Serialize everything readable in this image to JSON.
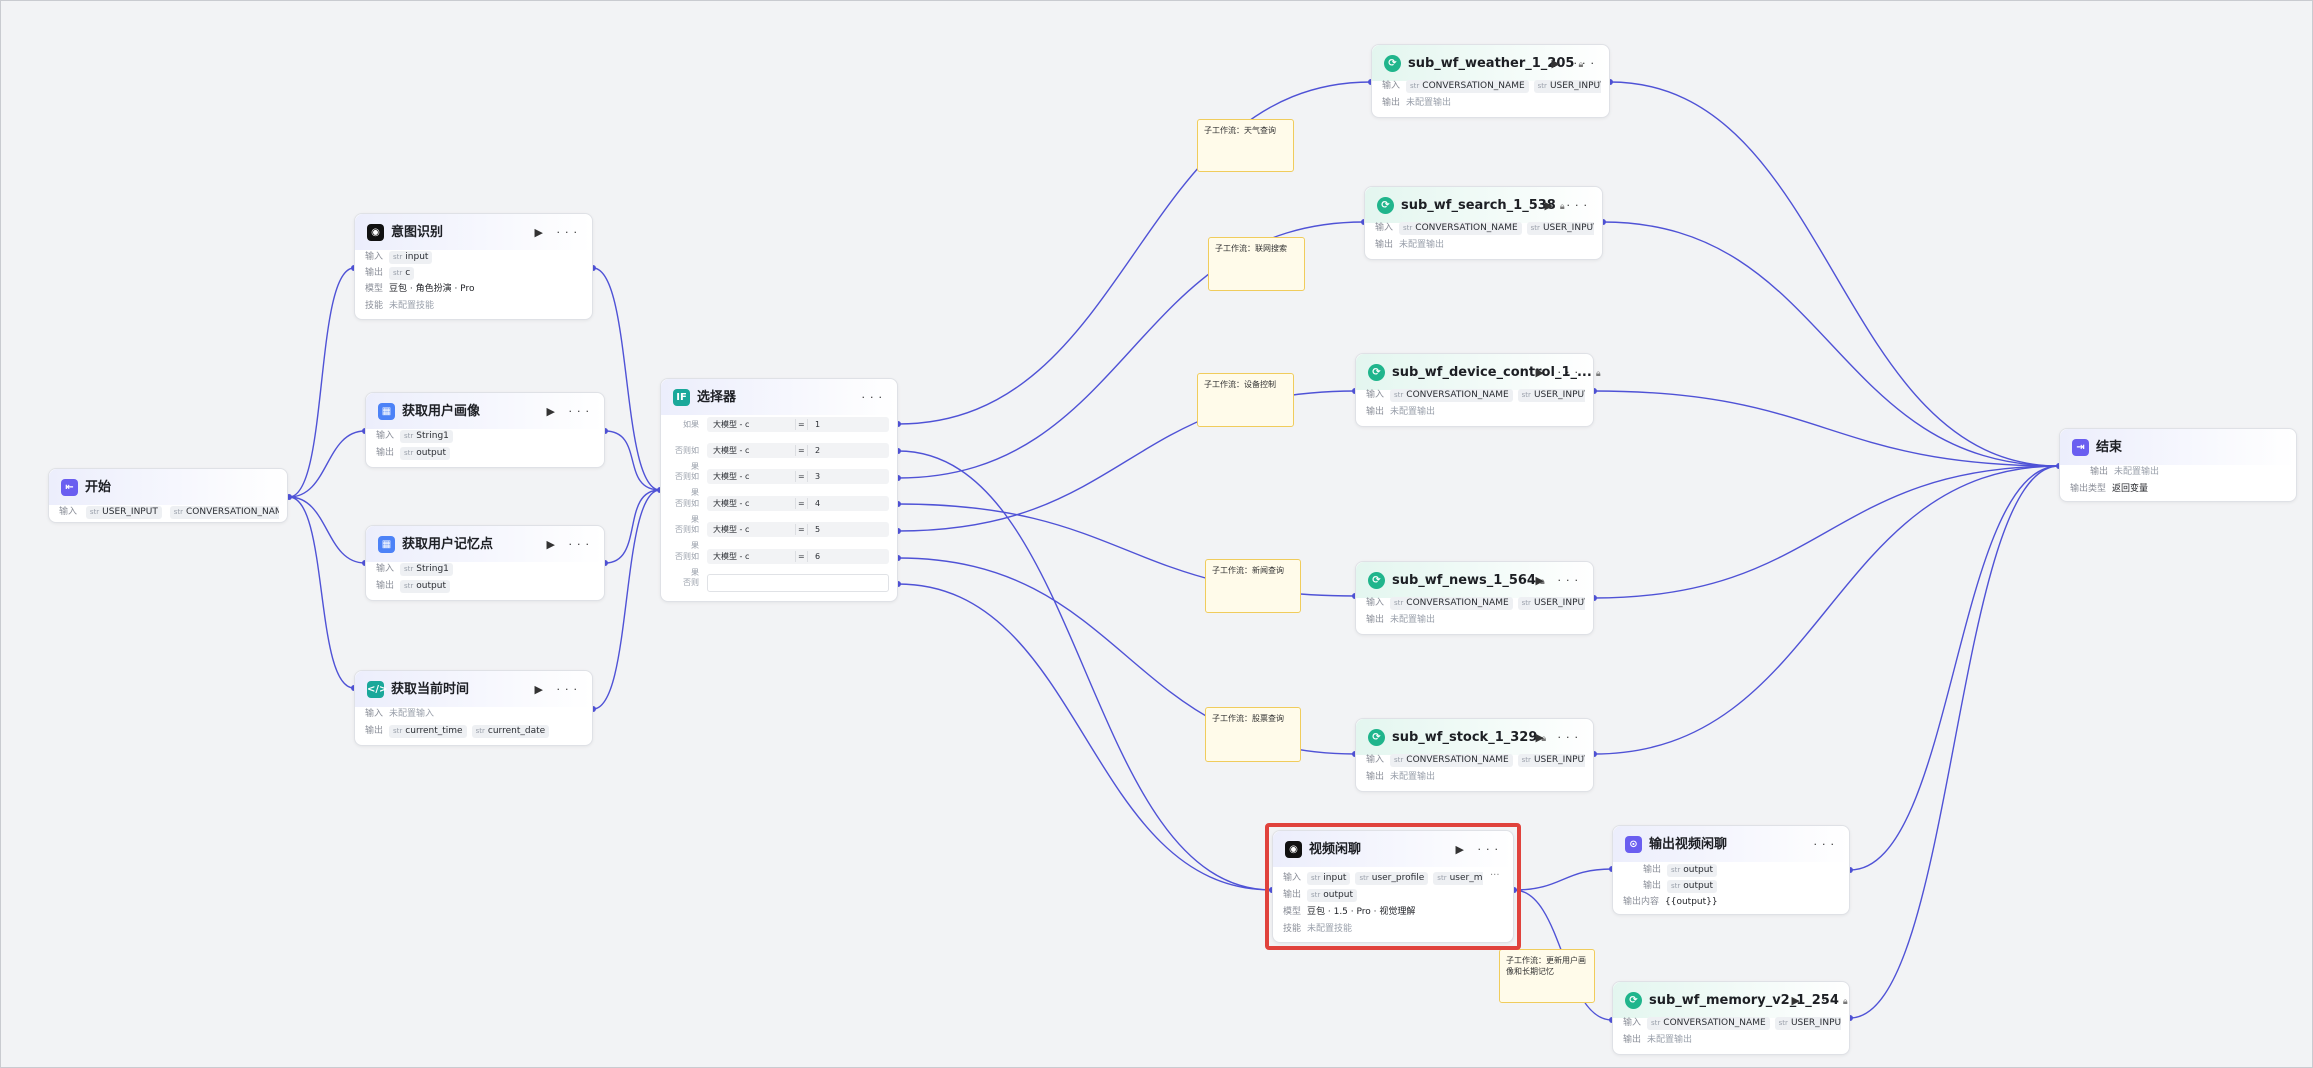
{
  "colors": {
    "wire": "#4f52d6",
    "highlight": "#e0423c",
    "note_bg": "#fffbea",
    "note_border": "#f0cc5c"
  },
  "labels": {
    "input": "输入",
    "output": "输出",
    "model": "模型",
    "skill": "技能",
    "unset_output": "未配置输出",
    "unset_skill": "未配置技能",
    "unset_input": "未配置输入",
    "output_content": "输出内容",
    "output_type": "输出类型",
    "branch_if": "如果",
    "branch_elif": "否则如果",
    "branch_else": "否则"
  },
  "start": {
    "title": "开始",
    "inputs": [
      "USER_INPUT",
      "CONVERSATION_NAME"
    ]
  },
  "intent": {
    "title": "意图识别",
    "input": "input",
    "output": "c",
    "model": "豆包 · 角色扮演 · Pro",
    "skill": "未配置技能"
  },
  "profile": {
    "title": "获取用户画像",
    "input": "String1",
    "output": "output"
  },
  "memory": {
    "title": "获取用户记忆点",
    "input": "String1",
    "output": "output"
  },
  "time": {
    "title": "获取当前时间",
    "input": "未配置输入",
    "outputs": [
      "current_time",
      "current_date"
    ]
  },
  "selector": {
    "title": "选择器",
    "branches": [
      {
        "label": "如果",
        "left": "大模型",
        "var": "c",
        "op": "=",
        "value": "1"
      },
      {
        "label": "否则如果",
        "left": "大模型",
        "var": "c",
        "op": "=",
        "value": "2"
      },
      {
        "label": "否则如果",
        "left": "大模型",
        "var": "c",
        "op": "=",
        "value": "3"
      },
      {
        "label": "否则如果",
        "left": "大模型",
        "var": "c",
        "op": "=",
        "value": "4"
      },
      {
        "label": "否则如果",
        "left": "大模型",
        "var": "c",
        "op": "=",
        "value": "5"
      },
      {
        "label": "否则如果",
        "left": "大模型",
        "var": "c",
        "op": "=",
        "value": "6"
      }
    ],
    "else_label": "否则"
  },
  "notes": {
    "weather": "子工作流：天气查询",
    "search": "子工作流：联网搜索",
    "device": "子工作流：设备控制",
    "news": "子工作流：新闻查询",
    "stock": "子工作流：股票查询",
    "memory": "子工作流：更新用户画像和长期记忆"
  },
  "subwf": {
    "weather": {
      "title": "sub_wf_weather_1_205",
      "inputs": [
        "CONVERSATION_NAME",
        "USER_INPUT"
      ],
      "output": "未配置输出"
    },
    "search": {
      "title": "sub_wf_search_1_538",
      "inputs": [
        "CONVERSATION_NAME",
        "USER_INPUT"
      ],
      "output": "未配置输出"
    },
    "device": {
      "title": "sub_wf_device_control_1_...",
      "inputs": [
        "CONVERSATION_NAME",
        "USER_INPUT"
      ],
      "output": "未配置输出"
    },
    "news": {
      "title": "sub_wf_news_1_564",
      "inputs": [
        "CONVERSATION_NAME",
        "USER_INPUT"
      ],
      "output": "未配置输出"
    },
    "stock": {
      "title": "sub_wf_stock_1_329",
      "inputs": [
        "CONVERSATION_NAME",
        "USER_INPUT"
      ],
      "output": "未配置输出"
    },
    "memory": {
      "title": "sub_wf_memory_v2_1_254",
      "inputs": [
        "CONVERSATION_NAME",
        "USER_INPUT"
      ],
      "output": "未配置输出"
    }
  },
  "video": {
    "title": "视频闲聊",
    "inputs": [
      "input",
      "user_profile",
      "user_memory"
    ],
    "output": "output",
    "model": "豆包 · 1.5 · Pro · 视觉理解",
    "skill": "未配置技能"
  },
  "vout": {
    "title": "输出视频闲聊",
    "outputs": [
      "output",
      "output"
    ],
    "content": "{{output}}"
  },
  "end": {
    "title": "结束",
    "output": "未配置输出",
    "type_value": "返回变量"
  }
}
